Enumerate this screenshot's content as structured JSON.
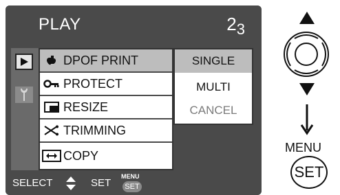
{
  "header": {
    "title": "PLAY",
    "page": "2",
    "page_total": "3"
  },
  "tabs": [
    {
      "name": "play"
    },
    {
      "name": "setup"
    }
  ],
  "menu_items": [
    {
      "label": "DPOF PRINT",
      "icon": "print-icon"
    },
    {
      "label": "PROTECT",
      "icon": "key-icon"
    },
    {
      "label": "RESIZE",
      "icon": "resize-icon"
    },
    {
      "label": "TRIMMING",
      "icon": "scissors-icon"
    },
    {
      "label": "COPY",
      "icon": "copy-icon"
    }
  ],
  "options": [
    {
      "label": "SINGLE"
    },
    {
      "label": "MULTI"
    },
    {
      "label": "CANCEL"
    }
  ],
  "footer": {
    "select_label": "SELECT",
    "set_label": "SET",
    "menu_small": "MENU",
    "set_small": "SET"
  },
  "right_panel": {
    "menu_label": "MENU",
    "set_button": "SET"
  }
}
